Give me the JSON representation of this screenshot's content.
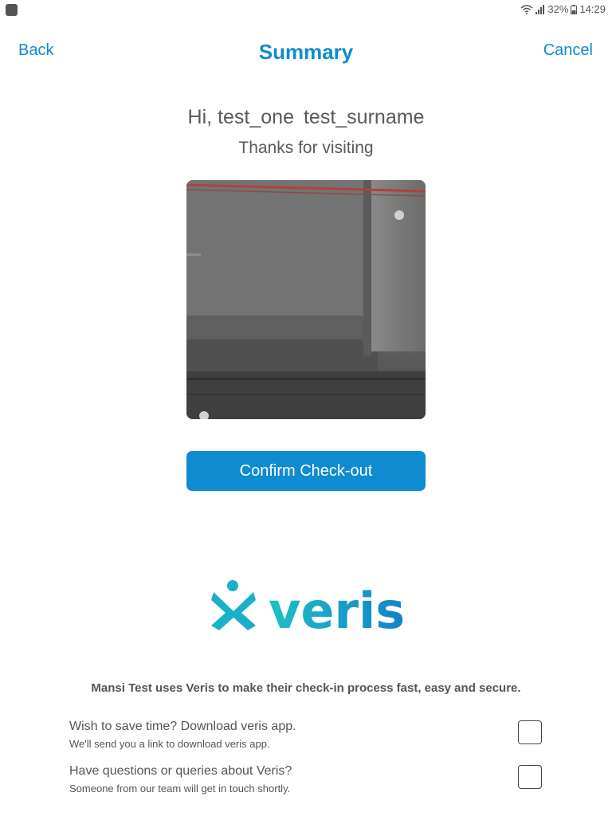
{
  "status_bar": {
    "battery": "32%",
    "time": "14:29",
    "icons": [
      "app-icon",
      "wifi-icon",
      "signal-icon",
      "battery-icon"
    ]
  },
  "nav": {
    "back_label": "Back",
    "title": "Summary",
    "cancel_label": "Cancel"
  },
  "greeting": {
    "prefix": "Hi,",
    "first_name": "test_one",
    "last_name": "test_surname",
    "subtitle": "Thanks for visiting"
  },
  "confirm_button_label": "Confirm Check-out",
  "logo_text": "veris",
  "powered_text": "Mansi Test uses Veris to make their check-in process fast, easy and secure.",
  "options": [
    {
      "title": "Wish to save time? Download veris app.",
      "description": "We'll send you a link to download veris app.",
      "checked": false
    },
    {
      "title": "Have questions or queries about Veris?",
      "description": "Someone from our team will get in touch shortly.",
      "checked": false
    }
  ],
  "colors": {
    "accent": "#0f8bd0",
    "text": "#555555",
    "logo_teal": "#1ab0c8"
  }
}
